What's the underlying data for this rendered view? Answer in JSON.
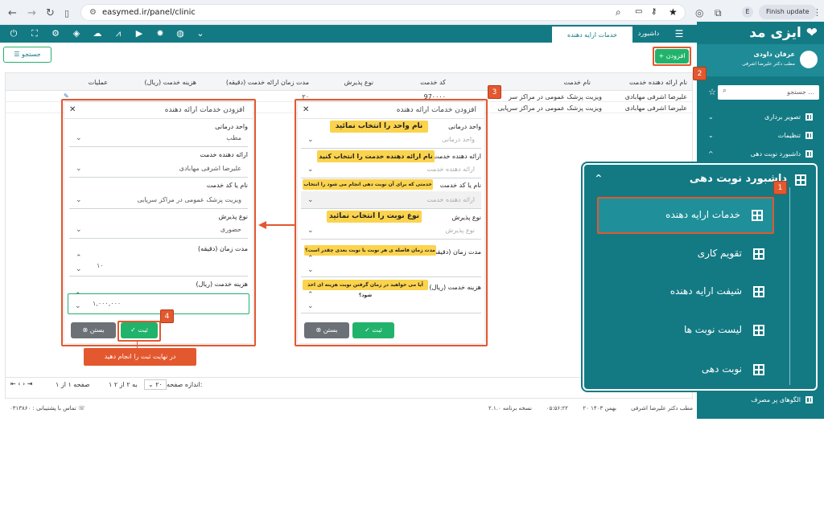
{
  "browser": {
    "url": "easymed.ir/panel/clinic",
    "profile_initial": "E",
    "update_label": "Finish update"
  },
  "header": {
    "tab_dashboard": "داشبورد",
    "tab_active": "خدمات ارایه دهنده",
    "logo": "ایزی مد"
  },
  "user": {
    "name": "عرفان داودی",
    "subtitle": "مطب دکتر علیرضا اشرفی"
  },
  "toolbar": {
    "add_label": "افزودن",
    "search_label": "جستجو",
    "search_placeholder": "جستجو ..."
  },
  "sidebar": {
    "items": [
      {
        "label": "تصویر برداری"
      },
      {
        "label": "تنظیمات"
      },
      {
        "label": "داشبورد نوبت دهی"
      }
    ],
    "bottom_item": "الگوهای پر مصرف"
  },
  "table": {
    "headers": [
      "نام ارائه دهنده خدمت",
      "نام خدمت",
      "کد خدمت",
      "نوع پذیرش",
      "مدت زمان ارائه خدمت (دقیقه)",
      "هزینه خدمت (ریال)",
      "عملیات"
    ],
    "rows": [
      {
        "provider": "علیرضا اشرفی مهابادی",
        "service": "ویزیت پزشک عمومی در مراکز سر",
        "code": "97۰۰۰۰",
        "duration": "۲۰"
      },
      {
        "provider": "علیرضا اشرفی مهابادی",
        "service": "ویزیت پزشک عمومی در مراکز سرپایی"
      }
    ]
  },
  "pagination": {
    "page_size_label": "اندازه صفحه:",
    "page_size": "۲۰",
    "range": "۱ به ۲ از ۲",
    "page": "صفحه ۱ از ۱"
  },
  "footer": {
    "clinic": "مطب دکتر علیرضا اشرفی",
    "date": "۲۰ بهمن ۱۴۰۳",
    "time": "۰۵:۵۶:۲۲",
    "version": "نسخه برنامه ۲.۱.۰",
    "support": "تماس با پشتیبانی : ۰۳۱۳۸۶۰"
  },
  "modal_left": {
    "title": "افزودن خدمات ارائه دهنده",
    "unit_label": "واحد درمانی",
    "unit_value": "مطب",
    "provider_label": "ارائه دهنده خدمت",
    "provider_value": "علیرضا اشرفی مهابادی",
    "service_label": "نام یا کد خدمت",
    "service_value": "ویزیت پزشک عمومی در مراکز سرپایی",
    "type_label": "نوع پذیرش",
    "type_value": "حضوری",
    "duration_label": "مدت زمان (دقیقه)",
    "duration_value": "۱۰",
    "cost_label": "هزینه خدمت (ریال)",
    "cost_value": "۱,۰۰۰,۰۰۰",
    "save": "ثبت",
    "close": "بستن"
  },
  "modal_right": {
    "title": "افزودن خدمات ارائه دهنده",
    "unit_label": "واحد درمانی",
    "unit_placeholder": "واحد درمانی",
    "provider_label": "ارائه دهنده خدمت",
    "provider_placeholder": "ارائه دهنده خدمت",
    "service_label": "نام یا کد خدمت",
    "service_placeholder": "ارائه دهنده خدمت",
    "type_label": "نوع پذیرش",
    "type_placeholder": "نوع پذیرش",
    "duration_label": "مدت زمان (دقیقه)",
    "cost_label": "هزینه خدمت (ریال)",
    "save": "ثبت",
    "close": "بستن",
    "hint_unit": "نام واحد را انتخاب نمائید",
    "hint_provider": "نام ارائه دهنده خدمت را انتخاب کنید",
    "hint_service": "خدمتی که برای آن نوبت دهی انجام می شود را انتخاب کنید",
    "hint_type": "نوع نوبت را انتخاب نمائید",
    "hint_duration": "مدت زمان فاصله ی هر نوبت با نوبت بعدی چقدر است؟",
    "hint_cost": "آیا می خواهید در زمان گرفتن نوبت هزینه ای اخذ شود؟"
  },
  "zoom_panel": {
    "header": "داشبورد نوبت دهی",
    "items": [
      "خدمات ارایه دهنده",
      "تقویم کاری",
      "شیفت ارایه دهنده",
      "لیست نوبت ها",
      "نوبت دهی"
    ]
  },
  "steps": {
    "one": "1",
    "two": "2",
    "three": "3",
    "four": "4",
    "final_note": "در نهایت ثبت را انجام دهید"
  },
  "colors": {
    "teal": "#137a84",
    "green": "#21b36b",
    "orange": "#e3582f",
    "yellow": "#fbd34d"
  }
}
